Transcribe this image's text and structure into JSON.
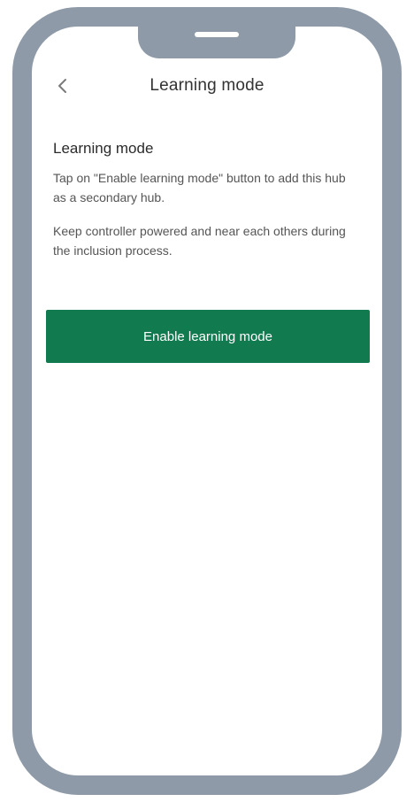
{
  "header": {
    "title": "Learning mode",
    "back_icon": "chevron-left-icon"
  },
  "content": {
    "section_title": "Learning mode",
    "paragraph_1": "Tap on \"Enable learning mode\" button to add this hub as a secondary hub.",
    "paragraph_2": "Keep controller powered and near each others during the inclusion process."
  },
  "actions": {
    "enable_label": "Enable learning mode"
  },
  "colors": {
    "frame": "#8e9aa8",
    "primary": "#117a4f",
    "text": "#333333"
  }
}
